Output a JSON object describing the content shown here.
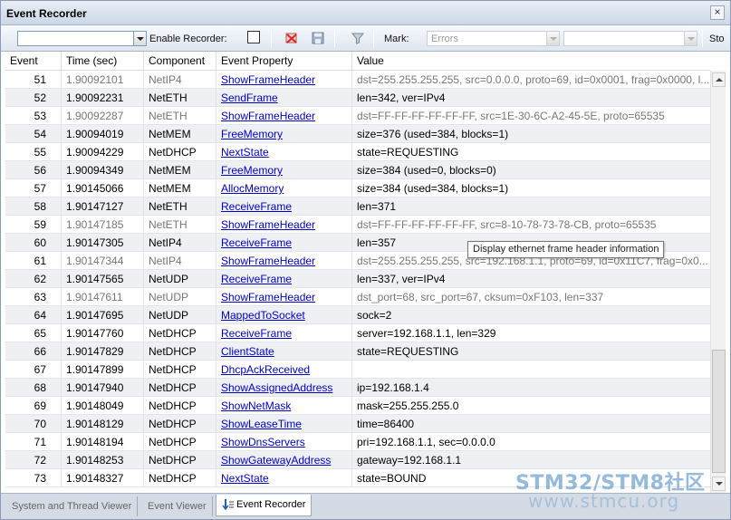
{
  "window": {
    "title": "Event Recorder",
    "close_glyph": "×"
  },
  "toolbar": {
    "filter_value": "",
    "enable_label": "Enable Recorder:",
    "mark_label": "Mark:",
    "mark_value": "Errors",
    "stop_label": "Sto",
    "icons": [
      "clear-icon",
      "save-icon",
      "filter-icon"
    ]
  },
  "columns": [
    "Event",
    "Time (sec)",
    "Component",
    "Event Property",
    "Value"
  ],
  "rows": [
    {
      "event": "51",
      "time": "1.90092101",
      "component": "NetIP4",
      "property": "ShowFrameHeader",
      "value": "dst=255.255.255.255, src=0.0.0.0, proto=69, id=0x0001, frag=0x0000, l...",
      "dim": true
    },
    {
      "event": "52",
      "time": "1.90092231",
      "component": "NetETH",
      "property": "SendFrame",
      "value": "len=342, ver=IPv4",
      "dim": false
    },
    {
      "event": "53",
      "time": "1.90092287",
      "component": "NetETH",
      "property": "ShowFrameHeader",
      "value": "dst=FF-FF-FF-FF-FF-FF, src=1E-30-6C-A2-45-5E, proto=65535",
      "dim": true
    },
    {
      "event": "54",
      "time": "1.90094019",
      "component": "NetMEM",
      "property": "FreeMemory",
      "value": "size=376 (used=384, blocks=1)",
      "dim": false
    },
    {
      "event": "55",
      "time": "1.90094229",
      "component": "NetDHCP",
      "property": "NextState",
      "value": "state=REQUESTING",
      "dim": false
    },
    {
      "event": "56",
      "time": "1.90094349",
      "component": "NetMEM",
      "property": "FreeMemory",
      "value": "size=384 (used=0, blocks=0)",
      "dim": false
    },
    {
      "event": "57",
      "time": "1.90145066",
      "component": "NetMEM",
      "property": "AllocMemory",
      "value": "size=384 (used=384, blocks=1)",
      "dim": false
    },
    {
      "event": "58",
      "time": "1.90147127",
      "component": "NetETH",
      "property": "ReceiveFrame",
      "value": "len=371",
      "dim": false
    },
    {
      "event": "59",
      "time": "1.90147185",
      "component": "NetETH",
      "property": "ShowFrameHeader",
      "value": "dst=FF-FF-FF-FF-FF-FF, src=8-10-78-73-78-CB, proto=65535",
      "dim": true
    },
    {
      "event": "60",
      "time": "1.90147305",
      "component": "NetIP4",
      "property": "ReceiveFrame",
      "value": "len=357",
      "dim": false
    },
    {
      "event": "61",
      "time": "1.90147344",
      "component": "NetIP4",
      "property": "ShowFrameHeader",
      "value": "dst=255.255.255.255, src=192.168.1.1, proto=69, id=0x11C7, frag=0x0...",
      "dim": true
    },
    {
      "event": "62",
      "time": "1.90147565",
      "component": "NetUDP",
      "property": "ReceiveFrame",
      "value": "len=337, ver=IPv4",
      "dim": false
    },
    {
      "event": "63",
      "time": "1.90147611",
      "component": "NetUDP",
      "property": "ShowFrameHeader",
      "value": "dst_port=68, src_port=67, cksum=0xF103, len=337",
      "dim": true
    },
    {
      "event": "64",
      "time": "1.90147695",
      "component": "NetUDP",
      "property": "MappedToSocket",
      "value": "sock=2",
      "dim": false
    },
    {
      "event": "65",
      "time": "1.90147760",
      "component": "NetDHCP",
      "property": "ReceiveFrame",
      "value": "server=192.168.1.1, len=329",
      "dim": false
    },
    {
      "event": "66",
      "time": "1.90147829",
      "component": "NetDHCP",
      "property": "ClientState",
      "value": "state=REQUESTING",
      "dim": false
    },
    {
      "event": "67",
      "time": "1.90147899",
      "component": "NetDHCP",
      "property": "DhcpAckReceived",
      "value": "",
      "dim": false
    },
    {
      "event": "68",
      "time": "1.90147940",
      "component": "NetDHCP",
      "property": "ShowAssignedAddress",
      "value": "ip=192.168.1.4",
      "dim": false
    },
    {
      "event": "69",
      "time": "1.90148049",
      "component": "NetDHCP",
      "property": "ShowNetMask",
      "value": "mask=255.255.255.0",
      "dim": false
    },
    {
      "event": "70",
      "time": "1.90148129",
      "component": "NetDHCP",
      "property": "ShowLeaseTime",
      "value": "time=86400",
      "dim": false
    },
    {
      "event": "71",
      "time": "1.90148194",
      "component": "NetDHCP",
      "property": "ShowDnsServers",
      "value": "pri=192.168.1.1, sec=0.0.0.0",
      "dim": false
    },
    {
      "event": "72",
      "time": "1.90148253",
      "component": "NetDHCP",
      "property": "ShowGatewayAddress",
      "value": "gateway=192.168.1.1",
      "dim": false
    },
    {
      "event": "73",
      "time": "1.90148327",
      "component": "NetDHCP",
      "property": "NextState",
      "value": "state=BOUND",
      "dim": false
    }
  ],
  "tooltip": "Display ethernet frame header information",
  "tabs": [
    {
      "label": "System and Thread Viewer",
      "active": false
    },
    {
      "label": "Event Viewer",
      "active": false
    },
    {
      "label": "Event Recorder",
      "active": true
    }
  ],
  "watermark": {
    "brand": "STM32/STM8社区",
    "url": "www.stmcu.org"
  },
  "colors": {
    "link": "#0000cc",
    "dim_text": "#777777",
    "alt_row": "#eef0f3",
    "title_bg": "#ccd7e6"
  }
}
